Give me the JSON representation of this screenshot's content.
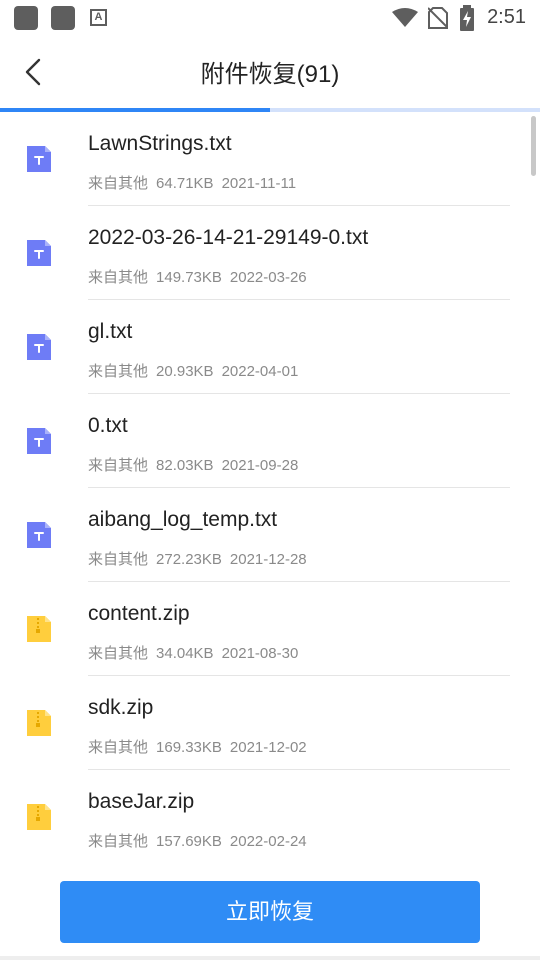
{
  "status_bar": {
    "time": "2:51",
    "icons": [
      "app-square-icon",
      "app-square-icon",
      "text-a-icon",
      "wifi-icon",
      "no-sim-icon",
      "battery-charging-icon"
    ]
  },
  "header": {
    "title": "附件恢复(91)",
    "back_icon": "chevron-left-icon"
  },
  "progress": {
    "value": 0.5,
    "fill_color": "#2F86F6",
    "track_color": "#D3E1FB"
  },
  "files": [
    {
      "name": "LawnStrings.txt",
      "source": "来自其他",
      "size": "64.71KB",
      "date": "2021-11-11",
      "type": "txt"
    },
    {
      "name": "2022-03-26-14-21-29149-0.txt",
      "source": "来自其他",
      "size": "149.73KB",
      "date": "2022-03-26",
      "type": "txt"
    },
    {
      "name": "gl.txt",
      "source": "来自其他",
      "size": "20.93KB",
      "date": "2022-04-01",
      "type": "txt"
    },
    {
      "name": "0.txt",
      "source": "来自其他",
      "size": "82.03KB",
      "date": "2021-09-28",
      "type": "txt"
    },
    {
      "name": "aibang_log_temp.txt",
      "source": "来自其他",
      "size": "272.23KB",
      "date": "2021-12-28",
      "type": "txt"
    },
    {
      "name": "content.zip",
      "source": "来自其他",
      "size": "34.04KB",
      "date": "2021-08-30",
      "type": "zip"
    },
    {
      "name": "sdk.zip",
      "source": "来自其他",
      "size": "169.33KB",
      "date": "2021-12-02",
      "type": "zip"
    },
    {
      "name": "baseJar.zip",
      "source": "来自其他",
      "size": "157.69KB",
      "date": "2022-02-24",
      "type": "zip"
    }
  ],
  "icon_colors": {
    "txt": "#6E7CF6",
    "zip": "#FFCE3D"
  },
  "footer": {
    "restore_label": "立即恢复",
    "button_color": "#2F8CF5"
  }
}
